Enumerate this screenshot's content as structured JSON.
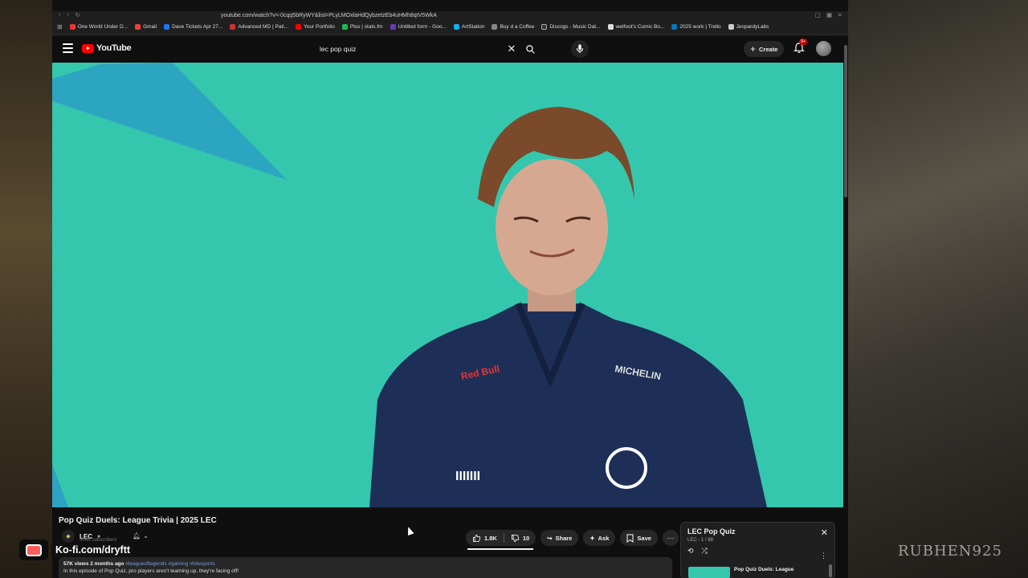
{
  "browser": {
    "url": "youtube.com/watch?v=-0cqq5bRyWY&list=PLyLMOxlaHdQybzetzEb4uHMh8qtV5WkA",
    "bookmarks": [
      "One World Under D...",
      "Gmail",
      "Dave Tickets Apr 27...",
      "Advanced MD | Pati...",
      "Your Portfolio",
      "Plus | stats.fm",
      "Untitled form - Goo...",
      "ArtStation",
      "Buy d a Coffee",
      "Discogs - Music Dat...",
      "wetfoot's Comic Bo...",
      "2025 work | Trello",
      "JeopardyLabs"
    ]
  },
  "header": {
    "logo_text": "YouTube",
    "search_value": "lec pop quiz",
    "create_label": "Create",
    "notif_badge": "9+"
  },
  "video": {
    "title": "Pop Quiz Duels: League Trivia | 2025 LEC",
    "channel": "LEC",
    "subscribers": "404K subscribers",
    "likes": "1.8K",
    "dislikes": "10",
    "share_label": "Share",
    "ask_label": "Ask",
    "save_label": "Save",
    "views": "57K views",
    "uploaded": "2 months ago",
    "tags": "#leagueoflegends #gaming #lolesports",
    "description": "In this episode of Pop Quiz, pro players aren't teaming up, they're facing off!"
  },
  "playlist": {
    "title": "LEC Pop Quiz",
    "subtitle": "LEC - 1 / 68",
    "item_title": "Pop Quiz Duels: League"
  },
  "overlay": {
    "kofi_text": "Ko-fi.com/dryftt",
    "watermark": "RUBHEN925"
  },
  "colors": {
    "video_bg": "#34c7ad",
    "brand_red": "#ff0000",
    "link_blue": "#7a9ad8"
  }
}
